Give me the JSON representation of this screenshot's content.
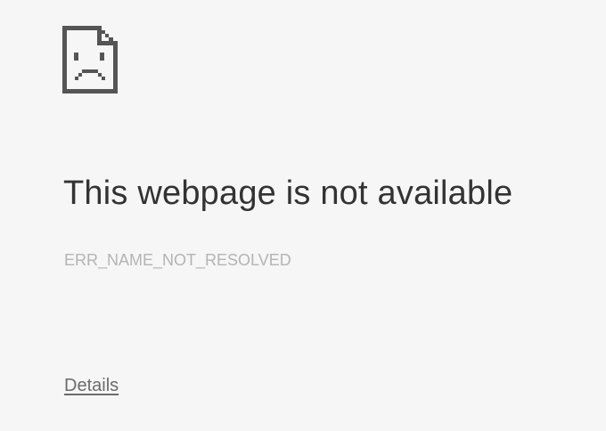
{
  "error_page": {
    "icon": "sad-page-icon",
    "title": "This webpage is not available",
    "error_code": "ERR_NAME_NOT_RESOLVED",
    "details_label": "Details"
  },
  "colors": {
    "background": "#f6f6f6",
    "title_text": "#333333",
    "error_code_text": "#b4b4b4",
    "details_text": "#6b6b6b",
    "icon": "#555555"
  }
}
